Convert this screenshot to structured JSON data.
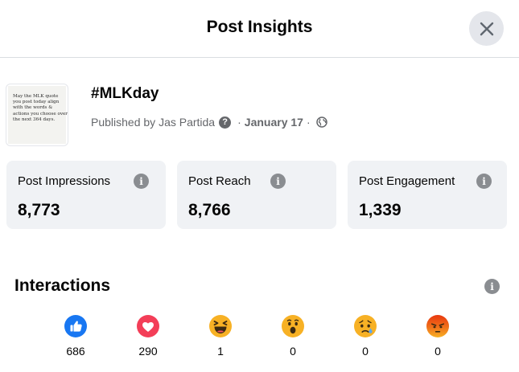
{
  "header": {
    "title": "Post Insights"
  },
  "post": {
    "thumbnail_text": "May the MLK quote you post today align with the words & actions you choose over the next 364 days.",
    "title": "#MLKday",
    "published_prefix": "Published by",
    "author": "Jas Partida",
    "separator": "·",
    "date": "January 17",
    "icons": {
      "help": "question-icon",
      "audience": "globe-icon"
    }
  },
  "metrics": [
    {
      "label": "Post Impressions",
      "value": "8,773"
    },
    {
      "label": "Post Reach",
      "value": "8,766"
    },
    {
      "label": "Post Engagement",
      "value": "1,339"
    }
  ],
  "interactions": {
    "title": "Interactions",
    "reactions": [
      {
        "icon": "like-icon",
        "count": "686"
      },
      {
        "icon": "love-icon",
        "count": "290"
      },
      {
        "icon": "haha-icon",
        "count": "1"
      },
      {
        "icon": "wow-icon",
        "count": "0"
      },
      {
        "icon": "sad-icon",
        "count": "0"
      },
      {
        "icon": "angry-icon",
        "count": "0"
      }
    ]
  },
  "colors": {
    "like": "#1877f2",
    "love": "#f33e58",
    "emoji_yellow": "#f7b125",
    "angry": "#e9710f",
    "card_bg": "#f0f2f5",
    "muted_text": "#65676b"
  }
}
